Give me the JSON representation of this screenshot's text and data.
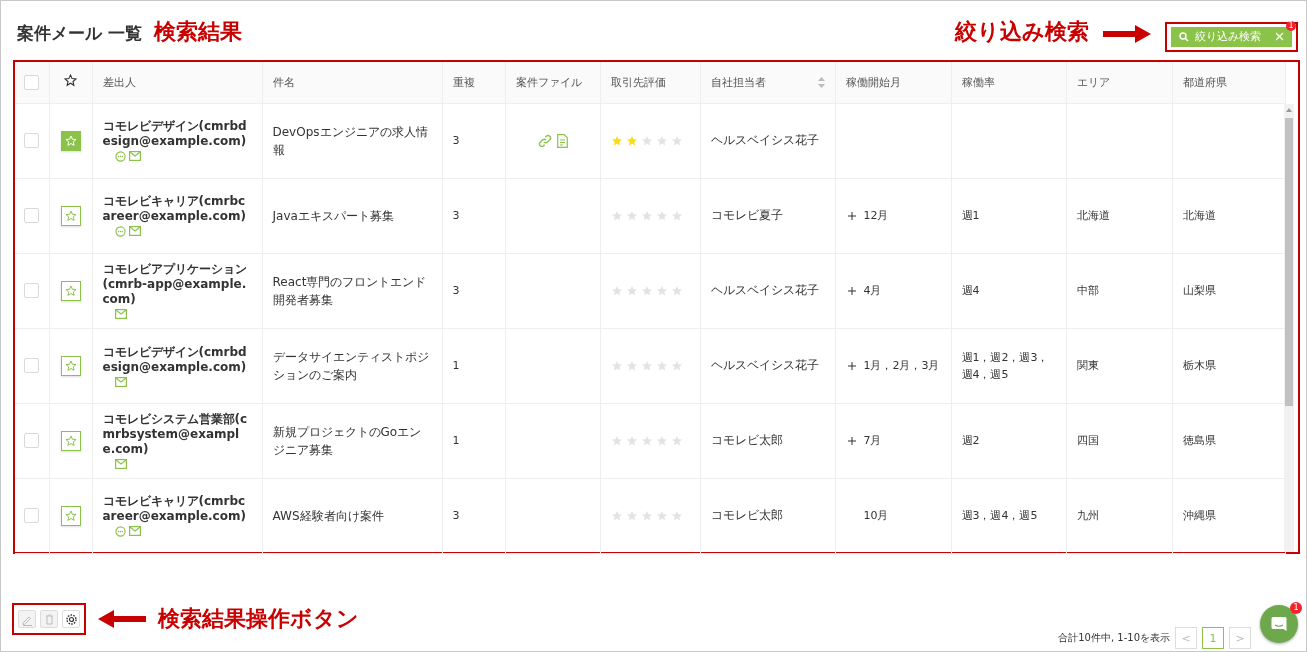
{
  "title": "案件メール 一覧",
  "annotations": {
    "results": "検索結果",
    "filter": "絞り込み検索",
    "actions": "検索結果操作ボタン"
  },
  "filter_button": {
    "label": "絞り込み検索",
    "badge": "1"
  },
  "table": {
    "header_checked": false,
    "columns": [
      {
        "label": "差出人",
        "sortable": false
      },
      {
        "label": "件名",
        "sortable": false
      },
      {
        "label": "重複",
        "sortable": false
      },
      {
        "label": "案件ファイル",
        "sortable": false
      },
      {
        "label": "取引先評価",
        "sortable": false
      },
      {
        "label": "自社担当者",
        "sortable": true
      },
      {
        "label": "稼働開始月",
        "sortable": false
      },
      {
        "label": "稼働率",
        "sortable": false
      },
      {
        "label": "エリア",
        "sortable": false
      },
      {
        "label": "都道府県",
        "sortable": false
      }
    ],
    "rows": [
      {
        "checked": false,
        "favorite": true,
        "sender": "コモレビデザイン(cmrbdesign@example.com)",
        "chat": true,
        "mail": true,
        "subject": "DevOpsエンジニアの求人情報",
        "duplicates": "3",
        "file_link": true,
        "file_document": true,
        "stars": 2,
        "person": "ヘルスベイシス花子"
      },
      {
        "checked": false,
        "favorite": false,
        "sender": "コモレビキャリア(cmrbcareer@example.com)",
        "chat": true,
        "mail": true,
        "subject": "Javaエキスパート募集",
        "duplicates": "3",
        "stars": 0,
        "person": "コモレビ夏子",
        "expandable": true,
        "start_month": "12月",
        "rate": "週1",
        "area": "北海道",
        "prefecture": "北海道"
      },
      {
        "checked": false,
        "favorite": false,
        "sender": "コモレビアプリケーション(cmrb-app@example.com)",
        "chat": false,
        "mail": true,
        "subject": "React専門のフロントエンド開発者募集",
        "duplicates": "3",
        "stars": 0,
        "person": "ヘルスベイシス花子",
        "expandable": true,
        "start_month": "4月",
        "rate": "週4",
        "area": "中部",
        "prefecture": "山梨県"
      },
      {
        "checked": false,
        "favorite": false,
        "sender": "コモレビデザイン(cmrbdesign@example.com)",
        "chat": false,
        "mail": true,
        "subject": "データサイエンティストポジションのご案内",
        "duplicates": "1",
        "stars": 0,
        "person": "ヘルスベイシス花子",
        "expandable": true,
        "start_month": "1月，2月，3月",
        "rate": "週1，週2，週3，週4，週5",
        "area": "関東",
        "prefecture": "栃木県"
      },
      {
        "checked": false,
        "favorite": false,
        "sender": "コモレビシステム営業部(cmrbsystem@example.com)",
        "chat": false,
        "mail": true,
        "subject": "新規プロジェクトのGoエンジニア募集",
        "duplicates": "1",
        "stars": 0,
        "person": "コモレビ太郎",
        "expandable": true,
        "start_month": "7月",
        "rate": "週2",
        "area": "四国",
        "prefecture": "徳島県"
      },
      {
        "checked": false,
        "favorite": false,
        "sender": "コモレビキャリア(cmrbcareer@example.com)",
        "chat": true,
        "mail": true,
        "subject": "AWS経験者向け案件",
        "duplicates": "3",
        "stars": 0,
        "person": "コモレビ太郎",
        "expandable": false,
        "start_month": "10月",
        "rate": "週3，週4，週5",
        "area": "九州",
        "prefecture": "沖縄県"
      }
    ]
  },
  "action_buttons": [
    {
      "kind": "edit",
      "disabled": true
    },
    {
      "kind": "delete",
      "disabled": true
    },
    {
      "kind": "settings",
      "disabled": false
    }
  ],
  "pagination": {
    "summary": "合計10件中, 1-10を表示",
    "prev": "<",
    "pages": [
      {
        "label": "1",
        "selected": true
      }
    ],
    "next": ">"
  },
  "chat_widget": {
    "badge": "1"
  }
}
